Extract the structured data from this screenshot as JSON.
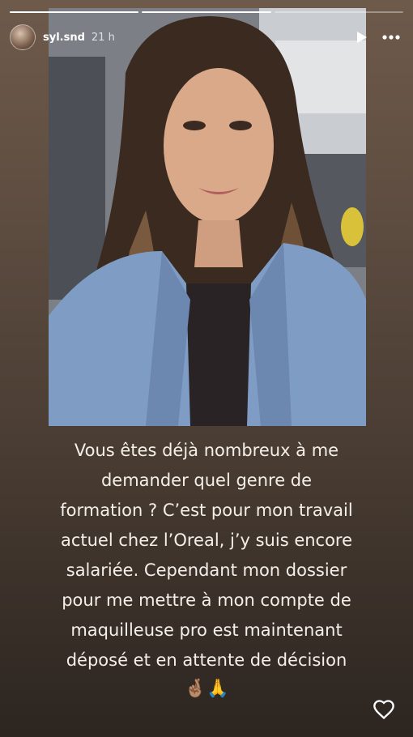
{
  "story": {
    "username": "syl.snd",
    "time_ago": "21 h",
    "progress": [
      1,
      1,
      0.0
    ],
    "caption_lines": [
      "Vous êtes déjà nombreux à me",
      "demander quel genre de",
      "formation ? C’est pour mon travail",
      "actuel chez l’Oreal, j’y suis encore",
      "salariée. Cependant mon dossier",
      "pour me mettre à mon compte de",
      "maquilleuse pro est maintenant",
      "déposé et en attente de décision"
    ],
    "emojis": "🤞🏽🙏"
  },
  "icons": {
    "play": "play-icon",
    "more": "more-icon",
    "like": "heart-icon"
  }
}
